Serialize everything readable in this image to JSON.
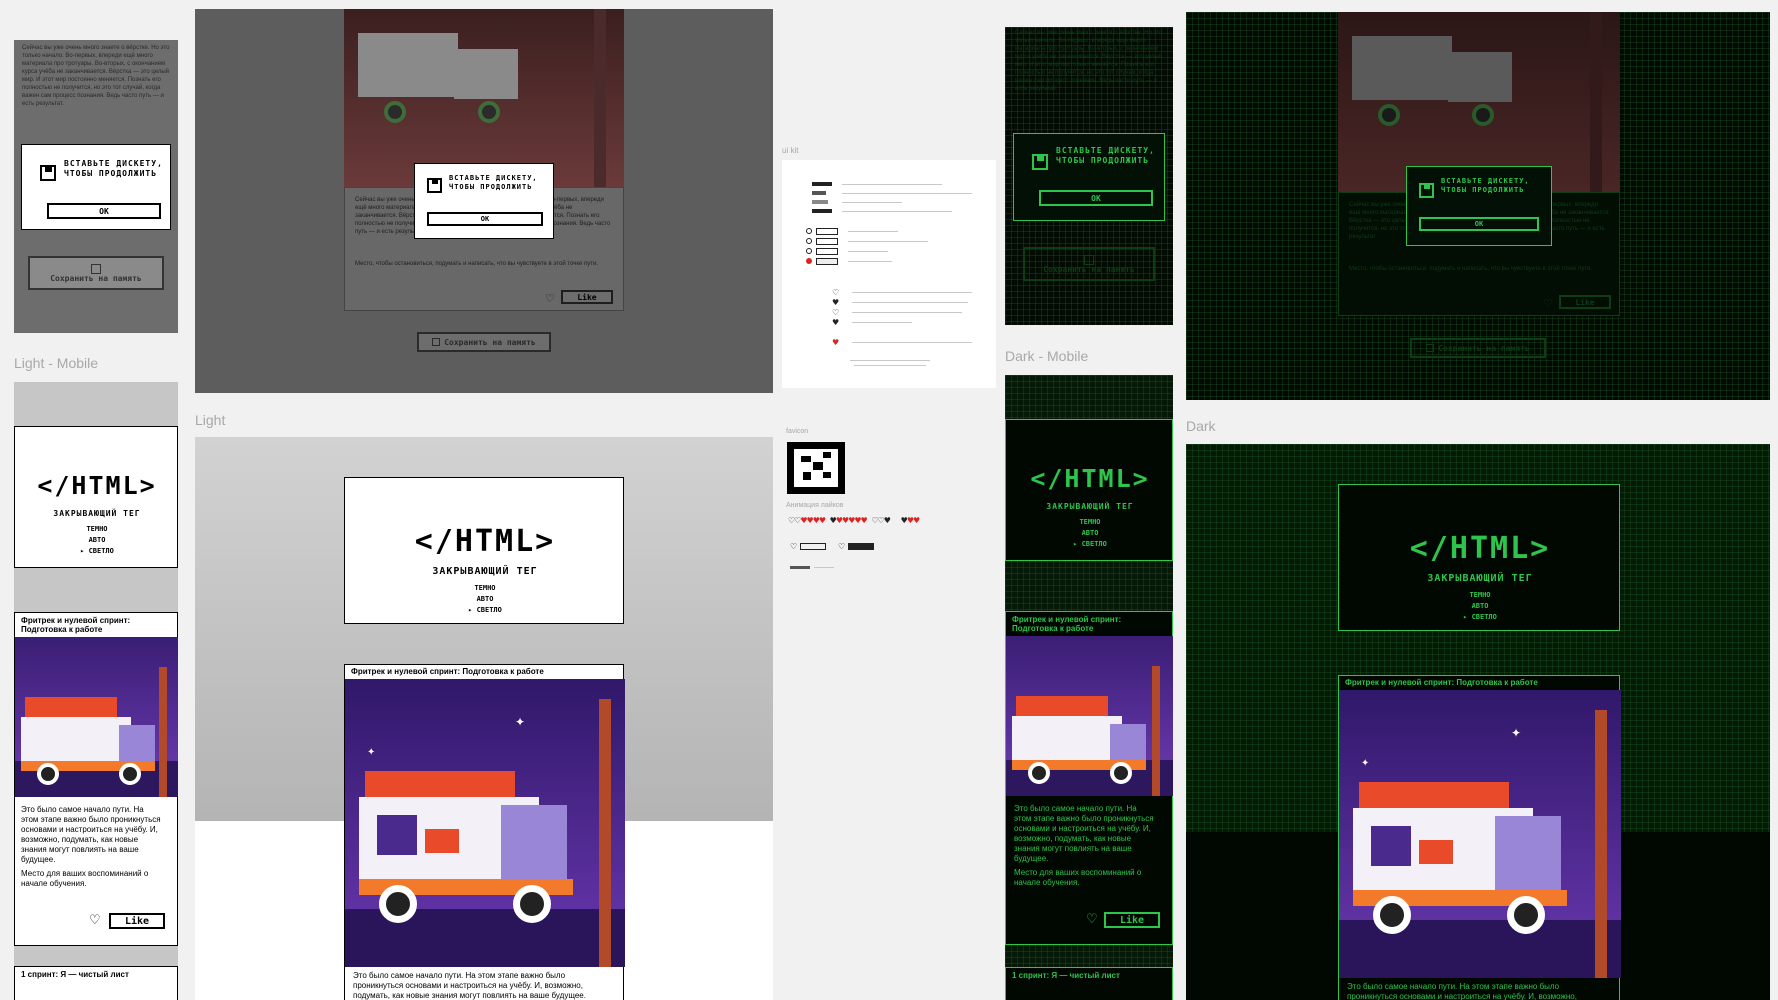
{
  "labels": {
    "light_mobile": "Light - Mobile",
    "light": "Light",
    "dark_mobile": "Dark - Mobile",
    "dark": "Dark",
    "ui_kit": "ui kit",
    "favicon": "favicon",
    "heart_anim": "Анимация лайков"
  },
  "header": {
    "title": "</HTML>",
    "subtitle": "ЗАКРЫВАЮЩИЙ ТЕГ",
    "theme_dark": "ТЕМНО",
    "theme_auto": "АВТО",
    "theme_light": "▸ СВЕТЛО"
  },
  "modal": {
    "text": "ВСТАВЬТЕ ДИСКЕТУ, ЧТОБЫ ПРОДОЛЖИТЬ",
    "ok": "OK"
  },
  "save_button": "Сохранить на память",
  "card1": {
    "title": "Фритрек и нулевой спринт: Подготовка к работе",
    "text": "Это было самое начало пути. На этом этапе важно было проникнуться основами и настроиться на учёбу. И, возможно, подумать, как новые знания могут повлиять на ваше будущее.",
    "memo": "Место для ваших воспоминаний о начале обучения.",
    "like": "Like"
  },
  "card2": {
    "title": "1 спринт: Я — чистый лист"
  },
  "bg_text": "Сейчас вы уже очень много знаете о вёрстке. Но это только начало. Во-первых, впереди ещё много материала про тротуары. Во-вторых, с окончанием курса учёба не заканчивается. Вёрстка — это целый мир. И этот мир постоянно меняется. Познать его полностью не получится, но это тот случай, когда важен сам процесс познания. Ведь часто путь — и есть результат.",
  "bg_text2": "Место, чтобы остановиться, подумать и написать, что вы чувствуете в этой точке пути.",
  "colors": {
    "green": "#2fc44b",
    "dark_bg": "#041a06",
    "purple": "#4a2a8c"
  }
}
